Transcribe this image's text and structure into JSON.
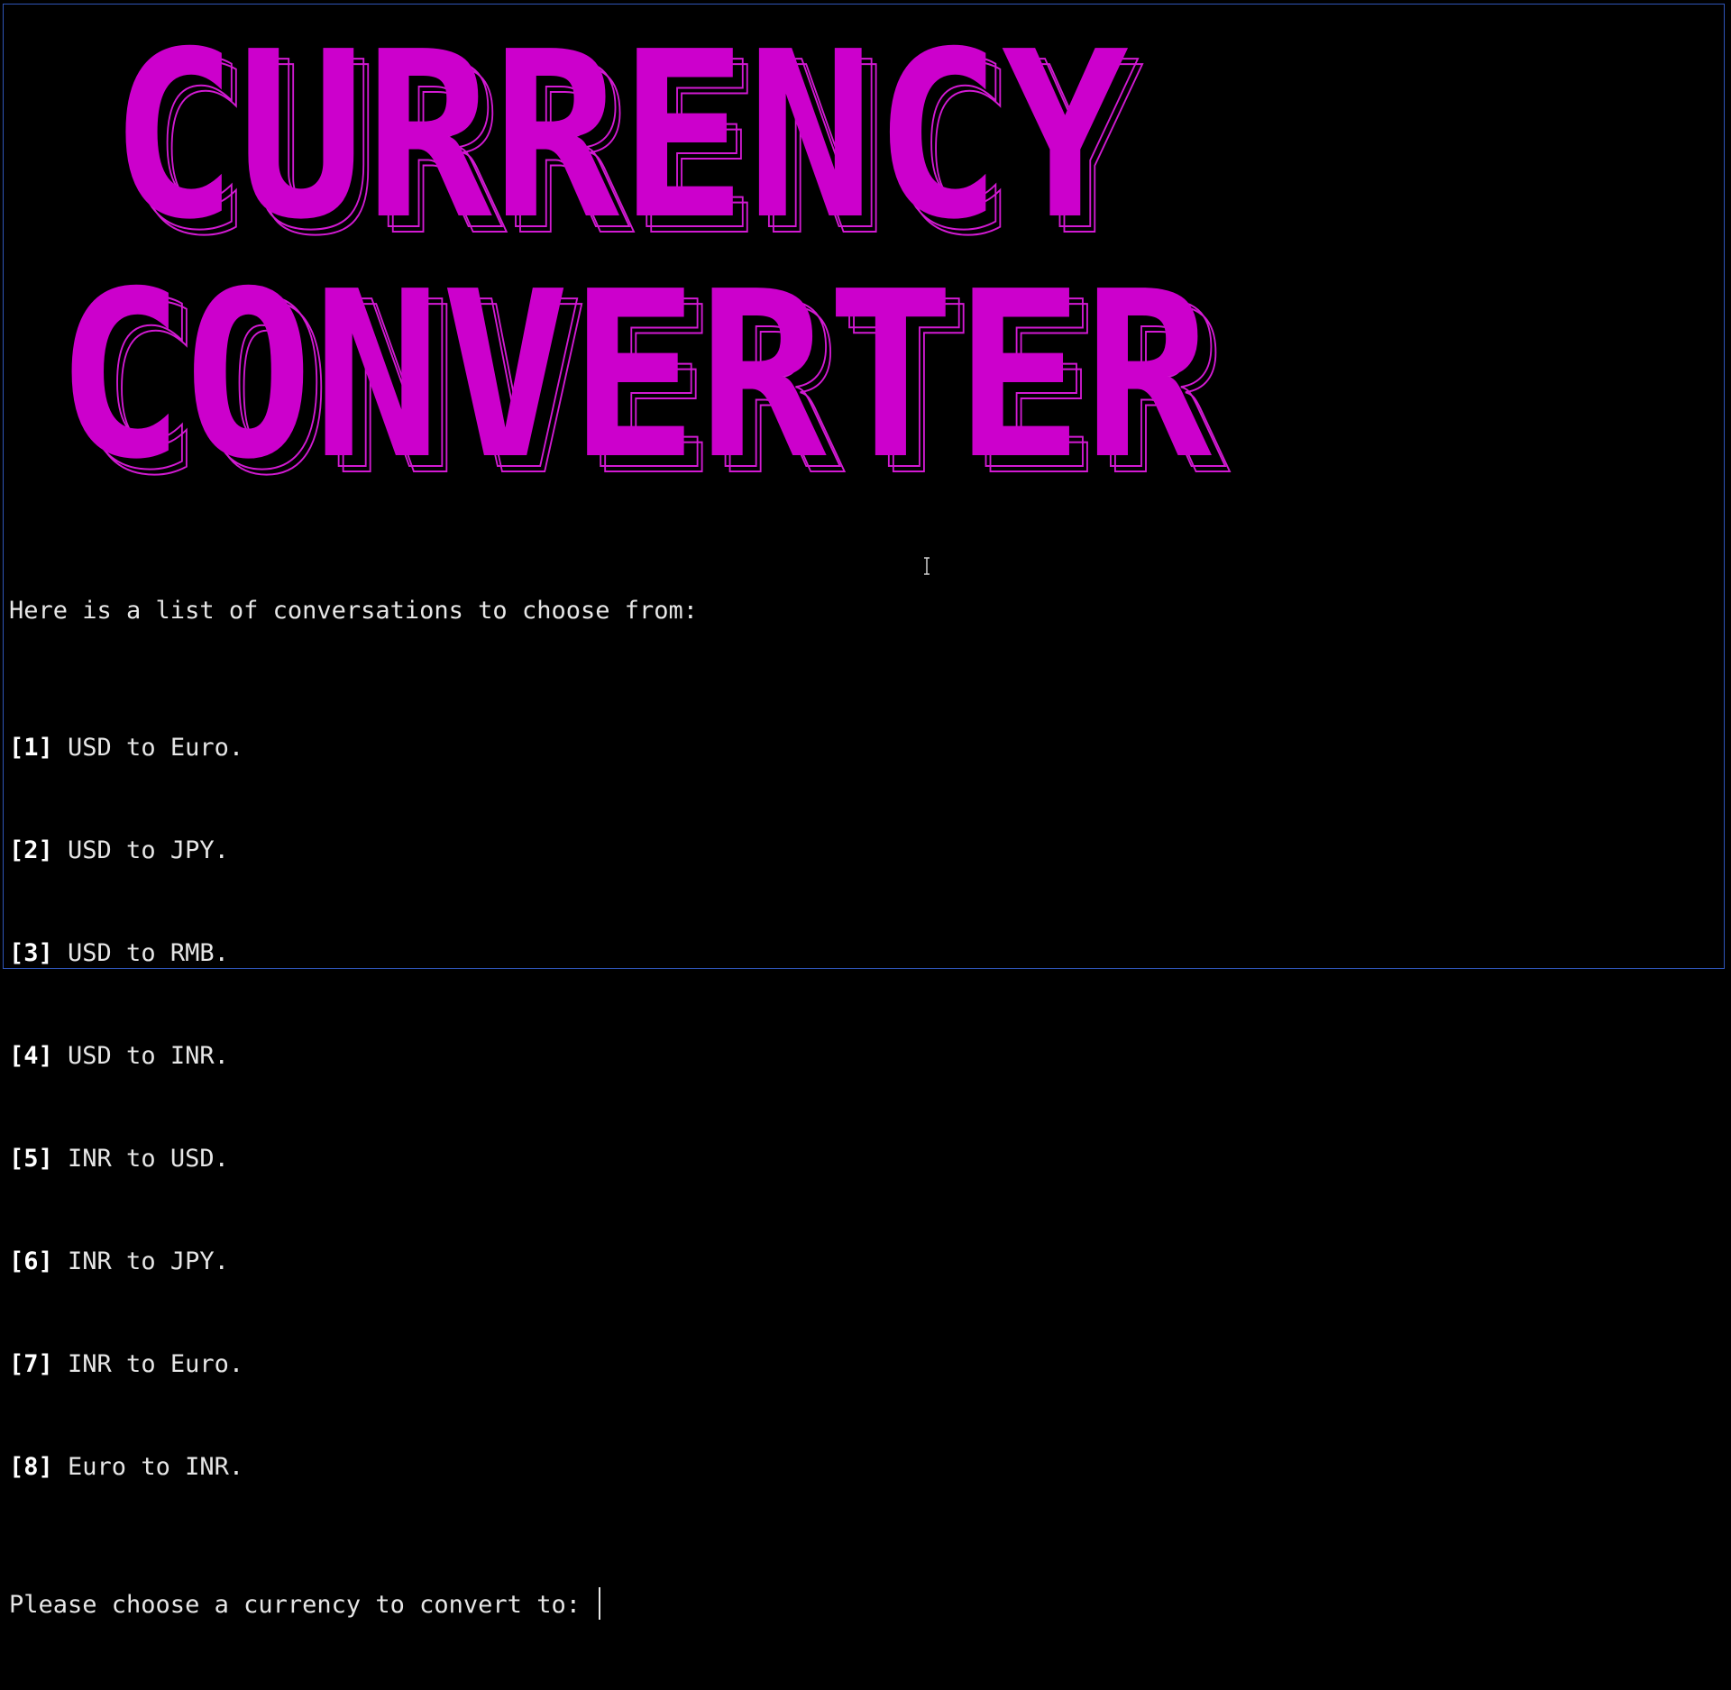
{
  "banner": {
    "line1": "CURRENCY",
    "line2": "CONVERTER",
    "color": "#cc00cc",
    "outline_color": "#d21ad2"
  },
  "terminal": {
    "intro": "Here is a list of conversations to choose from:",
    "options": [
      {
        "num": "[1]",
        "text": " USD to Euro."
      },
      {
        "num": "[2]",
        "text": " USD to JPY."
      },
      {
        "num": "[3]",
        "text": " USD to RMB."
      },
      {
        "num": "[4]",
        "text": " USD to INR."
      },
      {
        "num": "[5]",
        "text": " INR to USD."
      },
      {
        "num": "[6]",
        "text": " INR to JPY."
      },
      {
        "num": "[7]",
        "text": " INR to Euro."
      },
      {
        "num": "[8]",
        "text": " Euro to INR."
      }
    ],
    "prompt": "Please choose a currency to convert to: ",
    "text_color": "#e6e6e6"
  },
  "icons": {
    "cursor": "text-ibeam-icon"
  }
}
